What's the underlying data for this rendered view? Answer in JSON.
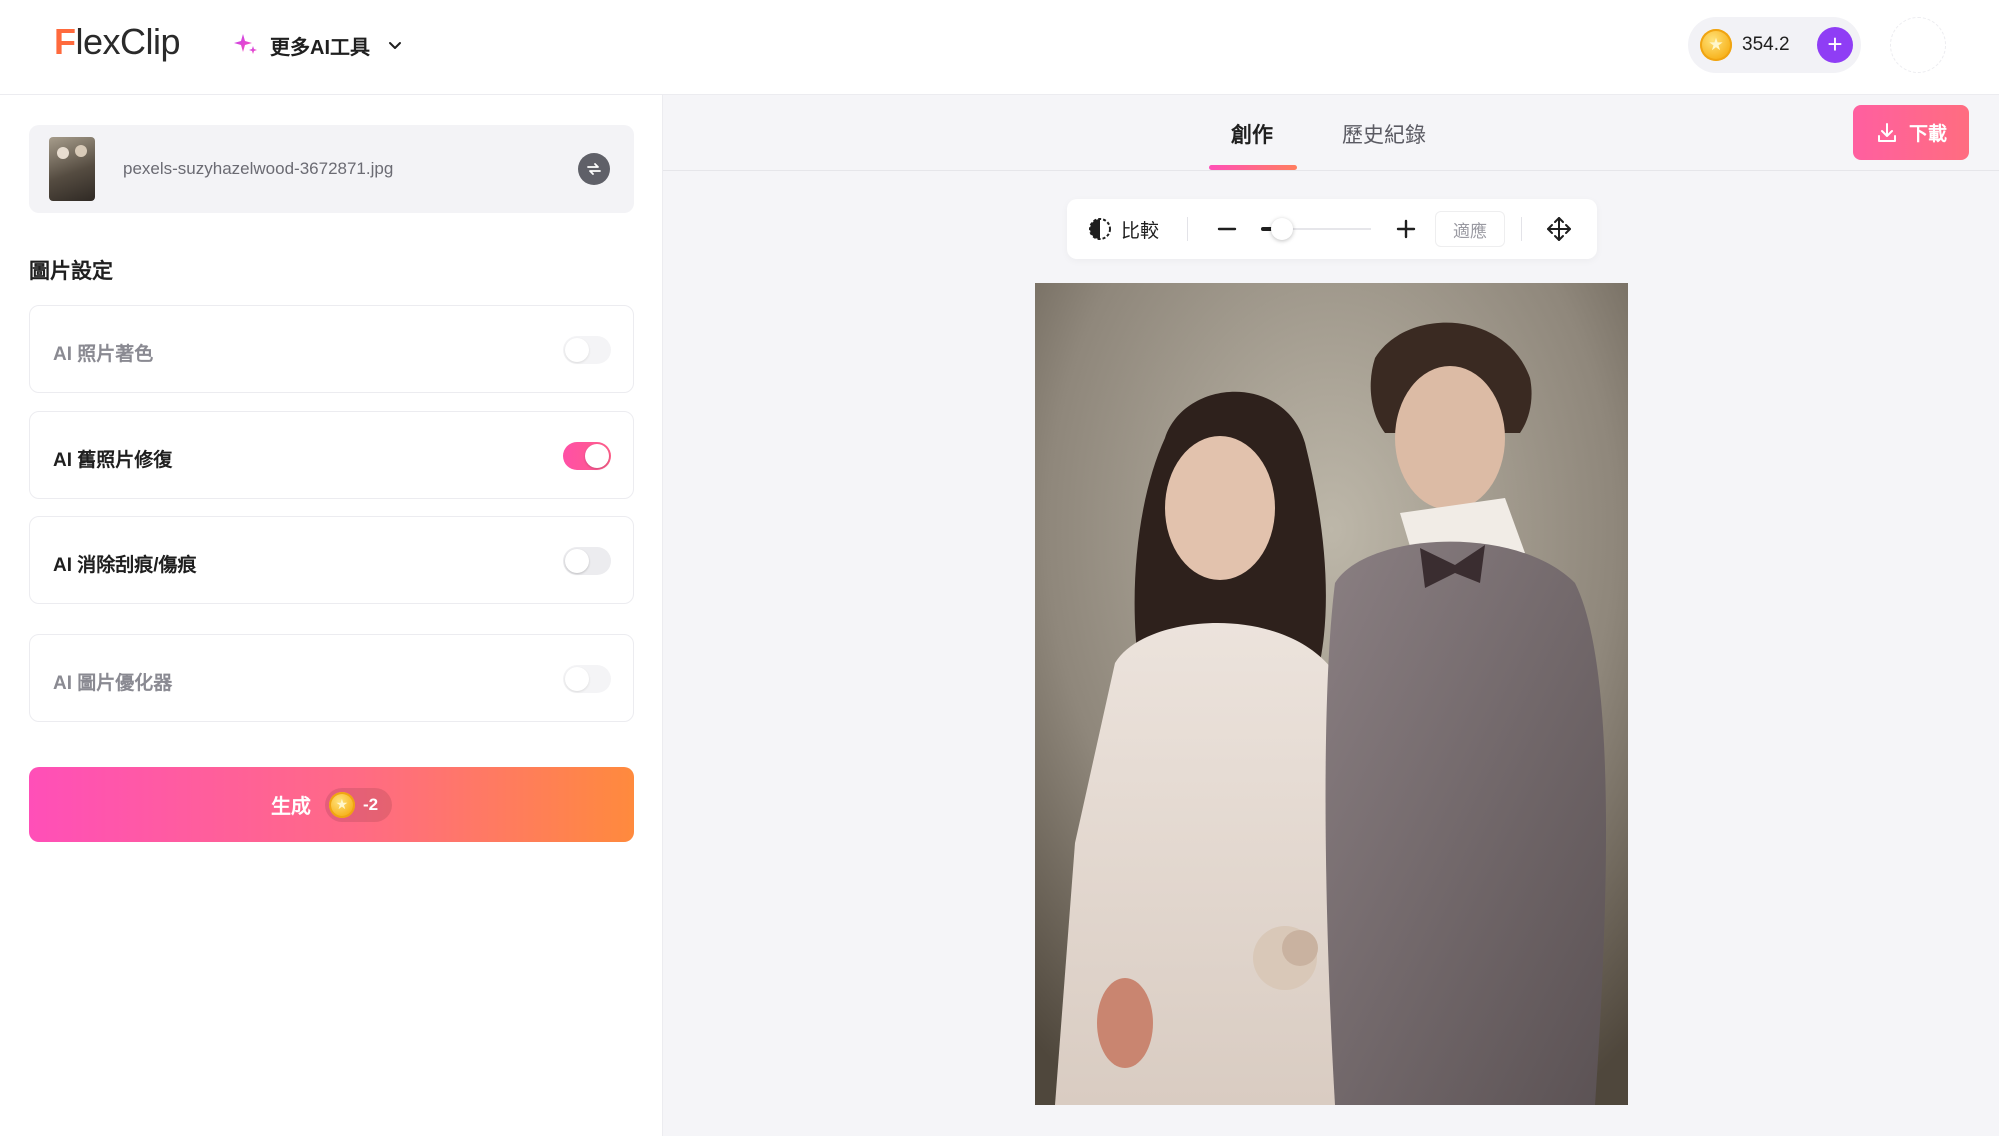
{
  "header": {
    "logo_first_letter": "F",
    "logo_rest": "lexClip",
    "more_ai_label": "更多AI工具",
    "credits_amount": "354.2",
    "plus_label": "+"
  },
  "sidebar": {
    "file_name": "pexels-suzyhazelwood-3672871.jpg",
    "section_title": "圖片設定",
    "options": [
      {
        "label": "AI 照片著色",
        "enabled": false
      },
      {
        "label": "AI 舊照片修復",
        "enabled": true
      },
      {
        "label": "AI 消除刮痕/傷痕",
        "enabled": false
      },
      {
        "label": "AI 圖片優化器",
        "enabled": false
      }
    ],
    "generate_label": "生成",
    "generate_cost": "-2"
  },
  "main": {
    "tabs": [
      {
        "label": "創作",
        "active": true
      },
      {
        "label": "歷史紀錄",
        "active": false
      }
    ],
    "download_label": "下載",
    "toolbar": {
      "compare_label": "比較",
      "fit_label": "適應",
      "zoom_level": 0.13
    }
  },
  "colors": {
    "accent_gradient_start": "#ff4fb8",
    "accent_gradient_end": "#ff8a3d",
    "credit_plus": "#8f3df5",
    "toggle_on": "#ff4fa6"
  },
  "icons": [
    "sparkle-icon",
    "chevron-down-icon",
    "coin-icon",
    "plus-icon",
    "replace-icon",
    "download-icon",
    "compare-icon",
    "zoom-out-icon",
    "zoom-in-icon",
    "move-icon"
  ]
}
